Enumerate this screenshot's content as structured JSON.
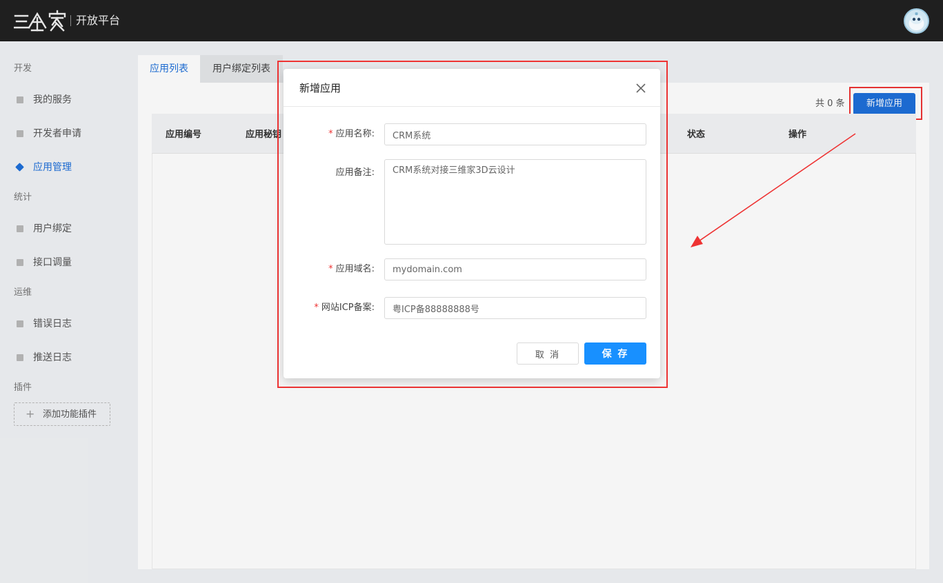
{
  "header": {
    "brand": "三维家",
    "platform_title": "开放平台"
  },
  "sidebar": {
    "groups": [
      "开发",
      "统计",
      "运维",
      "插件"
    ],
    "items": [
      {
        "label": "我的服务"
      },
      {
        "label": "开发者申请"
      },
      {
        "label": "应用管理"
      },
      {
        "label": "用户绑定"
      },
      {
        "label": "接口调量"
      },
      {
        "label": "错误日志"
      },
      {
        "label": "推送日志"
      }
    ],
    "plugin_button": "添加功能插件"
  },
  "tabs": [
    "应用列表",
    "用户绑定列表"
  ],
  "toolbar": {
    "count_text": "共 0 条",
    "add_label": "新增应用"
  },
  "table": {
    "columns": [
      "应用编号",
      "应用秘钥",
      "状态",
      "操作"
    ]
  },
  "modal": {
    "title": "新增应用",
    "fields": {
      "name": {
        "label": "应用名称:",
        "value": "CRM系统"
      },
      "remark": {
        "label": "应用备注:",
        "value": "CRM系统对接三维家3D云设计"
      },
      "domain": {
        "label": "应用域名:",
        "value": "mydomain.com"
      },
      "icp": {
        "label": "网站ICP备案:",
        "value": "粤ICP备88888888号"
      }
    },
    "cancel_label": "取 消",
    "save_label": "保 存"
  },
  "colors": {
    "accent": "#1e6fd9",
    "primary_button": "#1890ff",
    "annotation": "#e33333",
    "header_bg": "#1f1f1f"
  }
}
